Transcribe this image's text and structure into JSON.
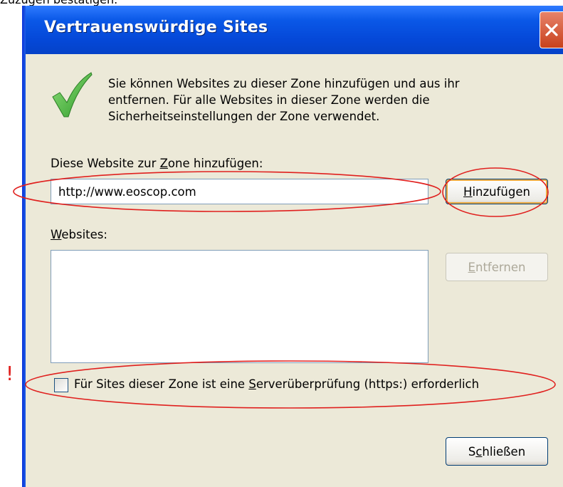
{
  "top_caption": "Zuzugen bestätigen.",
  "window": {
    "title": "Vertrauenswürdige Sites",
    "close_icon": "close-icon"
  },
  "intro": {
    "icon": "checkmark-icon",
    "lines": [
      "Sie können Websites zu dieser Zone hinzufügen und aus ihr",
      "entfernen. Für alle Websites in dieser Zone werden die",
      "Sicherheitseinstellungen der Zone verwendet."
    ]
  },
  "add_site": {
    "label_pre": "Diese Website zur ",
    "label_key": "Z",
    "label_post": "one hinzufügen:",
    "value": "http://www.eoscop.com",
    "button_key": "H",
    "button_rest": "inzufügen"
  },
  "sites": {
    "label_key": "W",
    "label_rest": "ebsites:",
    "items": [],
    "remove_key": "E",
    "remove_rest": "ntfernen"
  },
  "https_check": {
    "checked": false,
    "label_pre": "Für Sites dieser Zone ist eine ",
    "label_key": "S",
    "label_post": "erverüberprüfung (https:) erforderlich"
  },
  "close_button": {
    "pre": "S",
    "key": "c",
    "post": "hließen"
  },
  "annotations": {
    "mark": "!",
    "color": "#e0201e"
  }
}
